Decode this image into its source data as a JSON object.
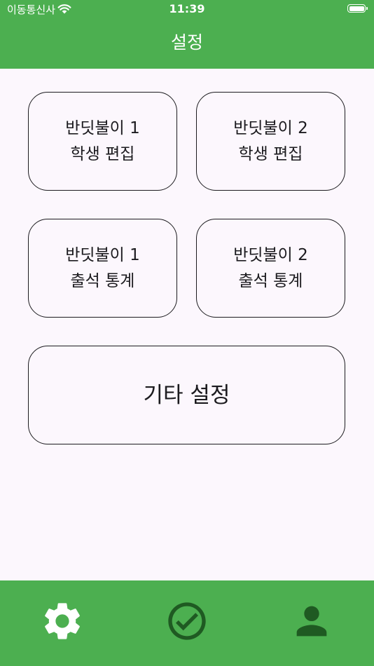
{
  "status_bar": {
    "carrier": "이동통신사",
    "time": "11:39",
    "wifi_icon": "wifi-icon",
    "battery_icon": "battery-icon"
  },
  "app_bar": {
    "title": "설정"
  },
  "menu": {
    "items": [
      {
        "line1": "반딧불이 1",
        "line2": "학생 편집"
      },
      {
        "line1": "반딧불이 2",
        "line2": "학생 편집"
      },
      {
        "line1": "반딧불이 1",
        "line2": "출석 통계"
      },
      {
        "line1": "반딧불이 2",
        "line2": "출석 통계"
      }
    ],
    "other_settings": "기타 설정"
  },
  "bottom_nav": {
    "items": [
      {
        "icon": "gear-icon",
        "selected": true
      },
      {
        "icon": "check-circle-icon",
        "selected": false
      },
      {
        "icon": "person-icon",
        "selected": false
      }
    ]
  },
  "colors": {
    "primary": "#4caf50",
    "background": "#fcf7fd",
    "on_primary": "#ffffff",
    "selected_icon": "#ffffff",
    "unselected_icon": "#1f5a22",
    "border": "#1c1b1f"
  }
}
